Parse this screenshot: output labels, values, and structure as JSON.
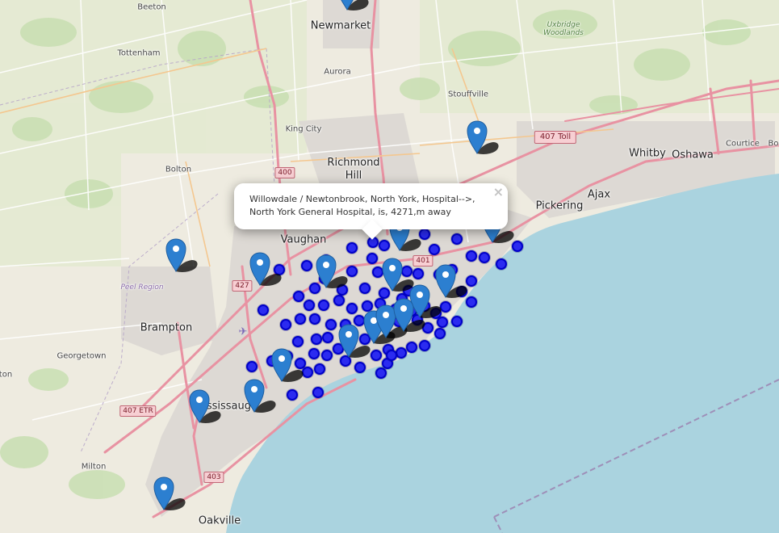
{
  "popup": {
    "line1": "Willowdale / Newtonbrook, North York, Hospital-->,",
    "line2": "North York General Hospital, is, 4271,m away",
    "close_label": "×"
  },
  "places": {
    "beeton": "Beeton",
    "newmarket": "Newmarket",
    "tottenham": "Tottenham",
    "uxbridge_woodlands": "Uxbridge Woodlands",
    "aurora": "Aurora",
    "stouffville": "Stouffville",
    "king_city": "King City",
    "richmond_hill": "Richmond Hill",
    "bolton": "Bolton",
    "whitby": "Whitby",
    "oshawa": "Oshawa",
    "courtice": "Courtice",
    "bo": "Bo",
    "ajax": "Ajax",
    "pickering": "Pickering",
    "vaughan": "Vaughan",
    "peel_region": "Peel Region",
    "brampton": "Brampton",
    "georgetown": "Georgetown",
    "ton": "ton",
    "mississauga": "Mississauga",
    "milton": "Milton",
    "oakville": "Oakville"
  },
  "shields": {
    "hwy400": "400",
    "hwy407toll": "407 Toll",
    "hwy401": "401",
    "hwy427": "427",
    "hwy407etr": "407 ETR",
    "hwy403": "403"
  },
  "colors": {
    "marker_blue": "#2c7fd0",
    "dot_fill": "#2b2bf0",
    "dot_stroke": "#0000c8",
    "water": "#aad3df",
    "land": "#efe9dd",
    "highway": "#e892a2",
    "popup_bg": "#ffffff"
  },
  "markers": {
    "hospital_count": 23,
    "circle_count": 118
  }
}
